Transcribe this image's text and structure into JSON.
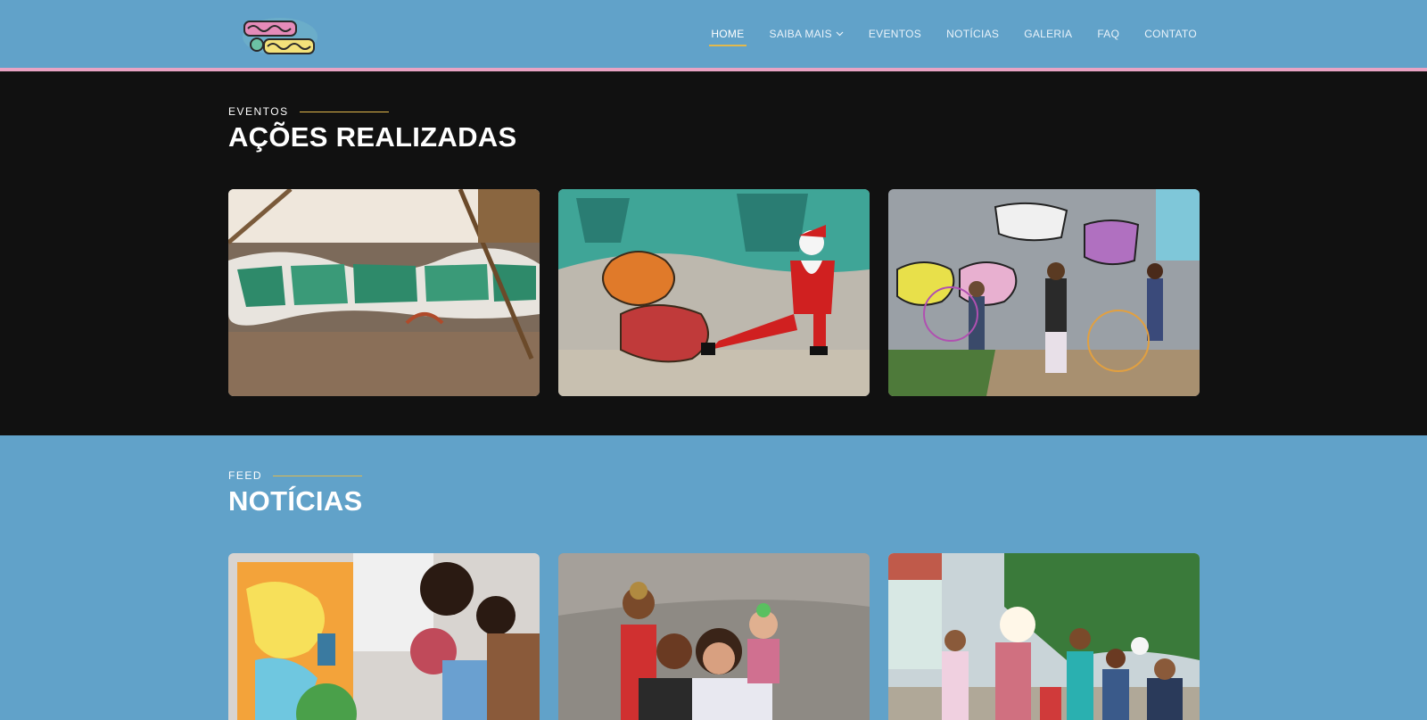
{
  "header": {
    "logo_alt": "Amigos do Bairro",
    "nav": [
      {
        "label": "HOME",
        "active": true
      },
      {
        "label": "SAIBA MAIS",
        "dropdown": true
      },
      {
        "label": "EVENTOS"
      },
      {
        "label": "NOTÍCIAS"
      },
      {
        "label": "GALERIA"
      },
      {
        "label": "FAQ"
      },
      {
        "label": "CONTATO"
      }
    ]
  },
  "events": {
    "eyebrow": "EVENTOS",
    "title": "AÇÕES REALIZADAS",
    "cards": [
      {
        "alt": "Graffiti wall Torre da Paz"
      },
      {
        "alt": "Santa Claus in front of Amigos do Bairro graffiti"
      },
      {
        "alt": "Children playing in front of graffiti wall"
      }
    ]
  },
  "feed": {
    "eyebrow": "FEED",
    "title": "NOTÍCIAS",
    "cards": [
      {
        "alt": "Children spray painting a canvas"
      },
      {
        "alt": "Kids posing with a girl in front of a wall"
      },
      {
        "alt": "Group of children in the street"
      }
    ]
  },
  "colors": {
    "header_bg": "#61a2c9",
    "header_border": "#e8a3c3",
    "accent": "#e2b94c",
    "events_bg": "#111111",
    "feed_bg": "#61a2c9"
  }
}
